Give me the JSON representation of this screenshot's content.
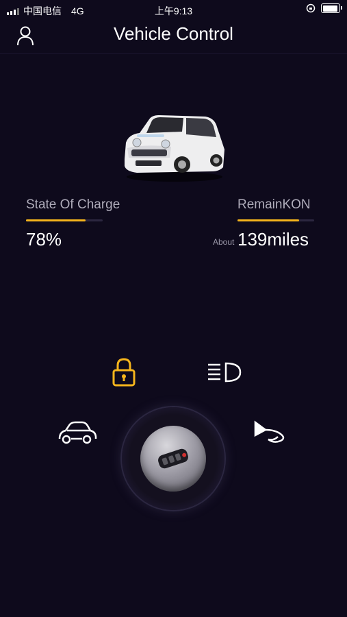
{
  "status_bar": {
    "carrier": "中国电信",
    "network": "4G",
    "time": "上午9:13"
  },
  "header": {
    "title": "Vehicle Control"
  },
  "metrics": {
    "charge": {
      "label": "State Of Charge",
      "value": "78%",
      "level": 0.78
    },
    "range": {
      "label": "RemainKON",
      "prefix": "About",
      "value": "139miles",
      "level": 0.8
    }
  },
  "controls": {
    "lock_icon": "lock-icon",
    "headlight_icon": "headlight-icon",
    "car_icon": "car-icon",
    "horn_icon": "horn-icon",
    "key_icon": "car-key-icon"
  },
  "colors": {
    "accent": "#f5b51c",
    "background": "#0e0a1c"
  }
}
